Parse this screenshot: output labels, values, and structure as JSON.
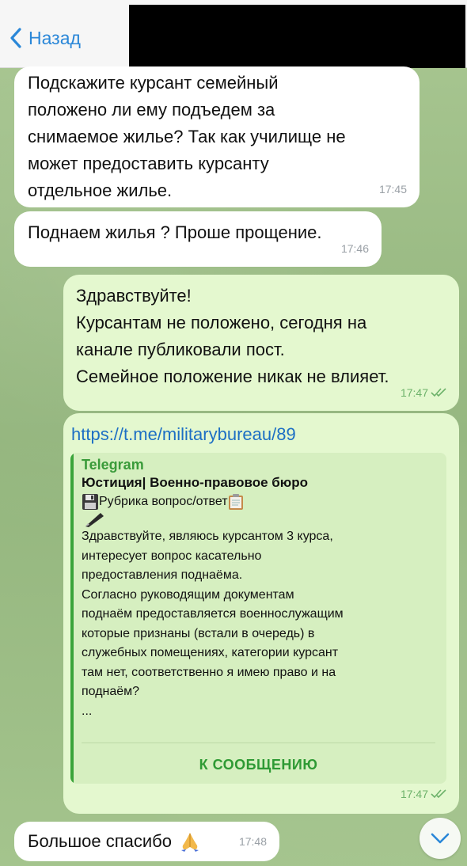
{
  "header": {
    "back_label": "Назад"
  },
  "messages": [
    {
      "lines": [
        "Подскажите курсант семейный",
        "положено ли ему подъедем за",
        "снимаемое жилье? Так как училище не",
        "может предоставить курсанту",
        "отдельное жилье."
      ],
      "time": "17:45"
    },
    {
      "text": "Поднаем жилья ? Проше прощение.",
      "time": "17:46"
    },
    {
      "lines": [
        "Здравствуйте!",
        "Курсантам не положено, сегодня на",
        "канале публиковали пост.",
        "Семейное положение никак не влияет."
      ],
      "time": "17:47"
    },
    {
      "link": "https://t.me/militarybureau/89",
      "preview": {
        "site": "Telegram",
        "title": "Юстиция| Военно-правовое бюро",
        "rubric": "Рубрика вопрос/ответ",
        "body": "Здравствуйте, являюсь курсантом 3 курса,\nинтересует вопрос касательно\nпредоставления поднаёма.\nСогласно руководящим документам\nподнаём предоставляется военнослужащим\nкоторые признаны (встали в очередь) в\nслужебных помещениях, категории курсант\nтам нет, соответственно я имею право и на\nподнаём?\n...",
        "button": "К СООБЩЕНИЮ"
      },
      "time": "17:47"
    },
    {
      "text": "Большое спасибо",
      "time": "17:48"
    }
  ],
  "colors": {
    "accent": "#2a87d8",
    "outgoing_bubble": "#e4f8cf",
    "incoming_bubble": "#ffffff",
    "preview_bar": "#3aa43a"
  },
  "icons": {
    "back": "chevron-left-icon",
    "read": "double-check-icon",
    "scroll": "chevron-down-icon",
    "floppy": "floppy-disk-icon",
    "clipboard": "clipboard-icon",
    "praying": "folded-hands-emoji"
  }
}
